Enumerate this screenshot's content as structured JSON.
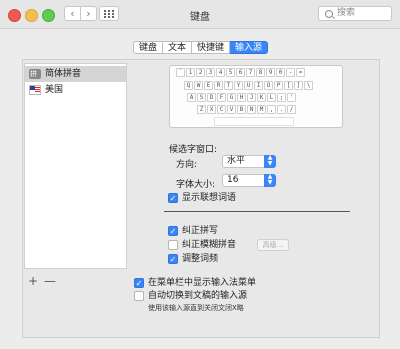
{
  "window": {
    "title": "键盘"
  },
  "toolbar": {
    "back_glyph": "‹",
    "forward_glyph": "›",
    "grid_icon": "grid-icon",
    "search_placeholder": "搜索"
  },
  "tabs": [
    {
      "label": "键盘",
      "active": false
    },
    {
      "label": "文本",
      "active": false
    },
    {
      "label": "快捷键",
      "active": false
    },
    {
      "label": "输入源",
      "active": true
    }
  ],
  "input_sources": [
    {
      "label": "简体拼音",
      "icon": "pinyin-icon",
      "selected": true
    },
    {
      "label": "美国",
      "icon": "us-flag-icon",
      "selected": false
    }
  ],
  "list_controls": {
    "add_glyph": "+",
    "remove_glyph": "—"
  },
  "keyboard_layout": {
    "rows": [
      [
        "`",
        "1",
        "2",
        "3",
        "4",
        "5",
        "6",
        "7",
        "8",
        "9",
        "0",
        "-",
        "="
      ],
      [
        "Q",
        "W",
        "E",
        "R",
        "T",
        "Y",
        "U",
        "I",
        "O",
        "P",
        "[",
        "]",
        "\\"
      ],
      [
        "A",
        "S",
        "D",
        "F",
        "G",
        "H",
        "J",
        "K",
        "L",
        ";",
        "'"
      ],
      [
        "Z",
        "X",
        "C",
        "V",
        "B",
        "N",
        "M",
        ",",
        ".",
        "/"
      ]
    ]
  },
  "candidate_window": {
    "heading": "候选字窗口:",
    "direction_label": "方向:",
    "direction_value": "水平",
    "font_size_label": "字体大小:",
    "font_size_value": "16",
    "show_predictive": {
      "label": "显示联想词语",
      "checked": true
    }
  },
  "options": {
    "spell_correct": {
      "label": "纠正拼写",
      "checked": true
    },
    "fuzzy_pinyin": {
      "label": "纠正模糊拼音",
      "checked": false
    },
    "advanced_button": "高级...",
    "adjust_frequency": {
      "label": "调整词频",
      "checked": true
    }
  },
  "bottom": {
    "show_in_menubar": {
      "label": "在菜单栏中显示输入法菜单",
      "checked": true
    },
    "auto_switch": {
      "label": "自动切换到文稿的输入源",
      "checked": false
    },
    "note": "使用该输入源直到关闭文闭X略"
  }
}
